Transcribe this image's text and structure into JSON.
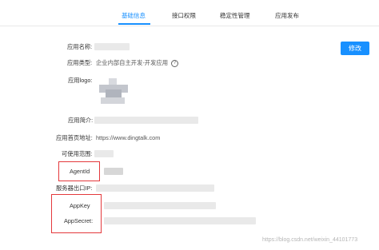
{
  "tabs": [
    {
      "label": "基础信息",
      "active": true
    },
    {
      "label": "接口权限",
      "active": false
    },
    {
      "label": "稳定性管理",
      "active": false
    },
    {
      "label": "应用发布",
      "active": false
    }
  ],
  "edit_button": "修改",
  "fields": {
    "app_name_label": "应用名称:",
    "app_type_label": "应用类型:",
    "app_type_value": "企业内部自主开发-开发应用",
    "app_logo_label": "应用logo:",
    "app_desc_label": "应用简介:",
    "homepage_label": "应用首页地址:",
    "homepage_value": "https://www.dingtalk.com",
    "scope_label": "可使用范围:",
    "agentid_label": "AgentId",
    "server_ip_label": "服务器出口IP:",
    "appkey_label": "AppKey",
    "appsecret_label": "AppSecret:"
  },
  "watermark": "https://blog.csdn.net/weixin_44101773",
  "colors": {
    "accent": "#1890ff",
    "highlight": "#e4393c"
  }
}
